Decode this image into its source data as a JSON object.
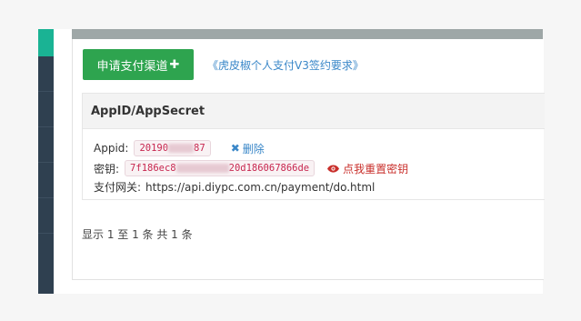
{
  "toolbar": {
    "apply_button_label": "申请支付渠道",
    "apply_button_icon": "plus-icon",
    "requirements_link": "《虎皮椒个人支付V3签约要求》"
  },
  "credentials": {
    "title": "AppID/AppSecret",
    "appid_label": "Appid:",
    "appid_value_start": "20190",
    "appid_value_end": "87",
    "delete_label": "删除",
    "delete_icon": "close-icon",
    "secret_label": "密钥:",
    "secret_value_start": "7f186ec8",
    "secret_value_end": "20d186067866de",
    "reset_label": "点我重置密钥",
    "reset_icon": "eye-icon",
    "gateway_label": "支付网关:",
    "gateway_url": "https://api.diypc.com.cn/payment/do.html"
  },
  "pagination": {
    "summary": "显示 1 至 1 条  共 1 条"
  },
  "colors": {
    "sidebar": "#2f4050",
    "sidebar_accent": "#1ab394",
    "apply_button": "#2ea44f",
    "link": "#3a87c8",
    "code_text": "#c7254e",
    "danger": "#c9302c"
  }
}
